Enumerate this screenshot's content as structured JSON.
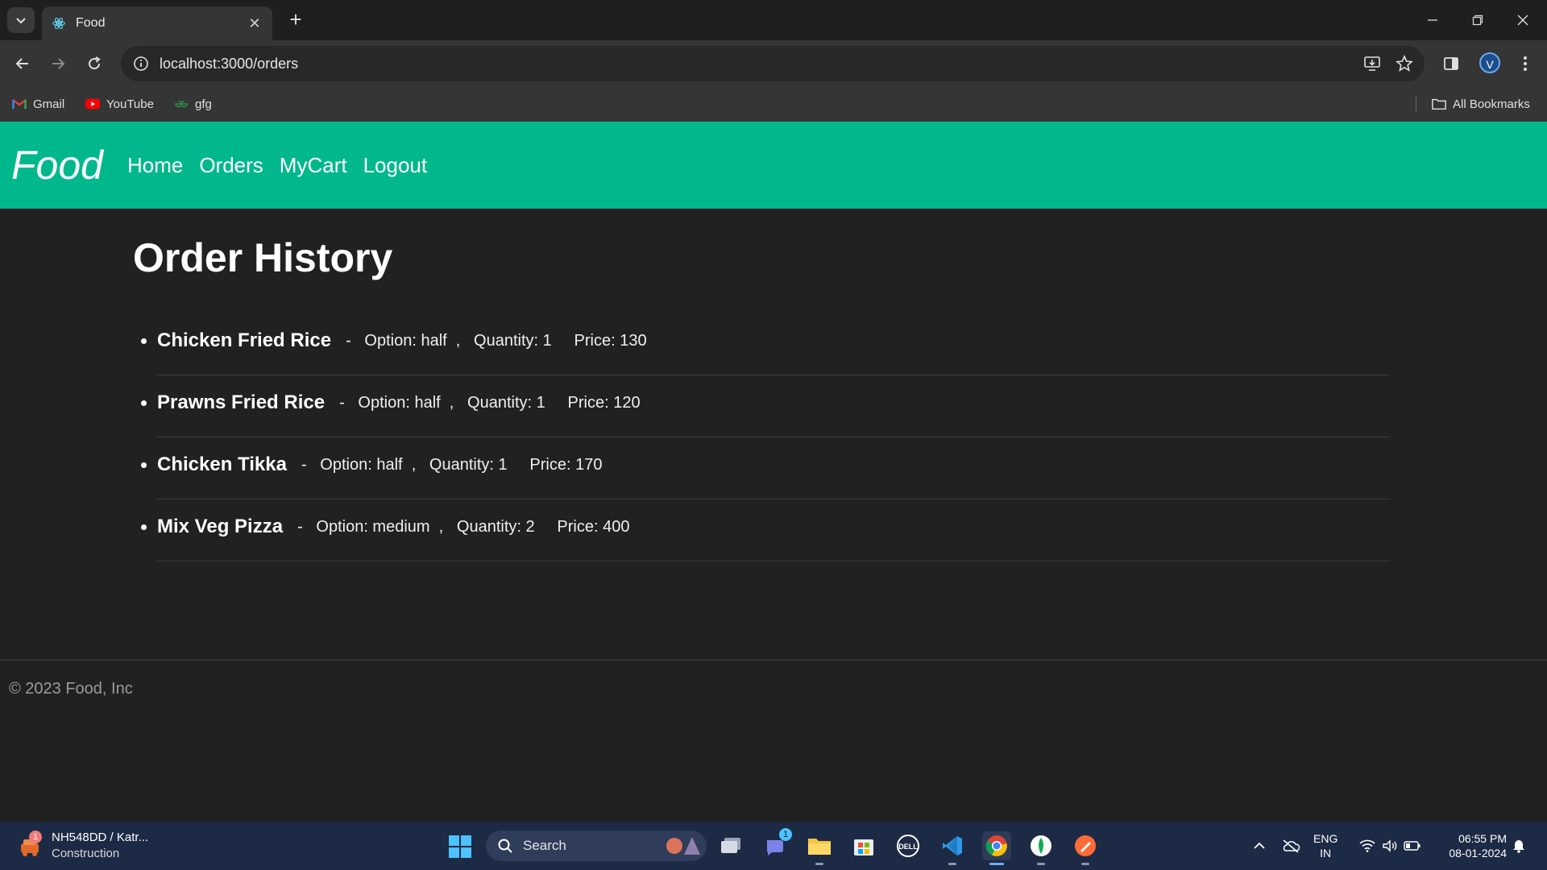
{
  "browser": {
    "tab_title": "Food",
    "url": "localhost:3000/orders",
    "avatar_letter": "V",
    "bookmarks": [
      {
        "label": "Gmail"
      },
      {
        "label": "YouTube"
      },
      {
        "label": "gfg"
      }
    ],
    "all_bookmarks": "All Bookmarks"
  },
  "navbar": {
    "brand": "Food",
    "links": [
      "Home",
      "Orders",
      "MyCart",
      "Logout"
    ]
  },
  "page": {
    "heading": "Order History",
    "orders": [
      {
        "name": "Chicken Fried Rice",
        "details": "-   Option: half  ,   Quantity: 1     Price: 130"
      },
      {
        "name": "Prawns Fried Rice",
        "details": "-   Option: half  ,   Quantity: 1     Price: 120"
      },
      {
        "name": "Chicken Tikka",
        "details": "-   Option: half  ,   Quantity: 1     Price: 170"
      },
      {
        "name": "Mix Veg Pizza",
        "details": "-   Option: medium  ,   Quantity: 2     Price: 400"
      }
    ],
    "footer": "© 2023 Food, Inc"
  },
  "taskbar": {
    "notification_line1": "NH548DD / Katr...",
    "notification_line2": "Construction",
    "notification_count": "1",
    "search_placeholder": "Search",
    "teams_badge": "1",
    "lang_line1": "ENG",
    "lang_line2": "IN",
    "time": "06:55 PM",
    "date": "08-01-2024"
  },
  "colors": {
    "navbar_bg": "#00b88c",
    "page_bg": "#212121"
  }
}
